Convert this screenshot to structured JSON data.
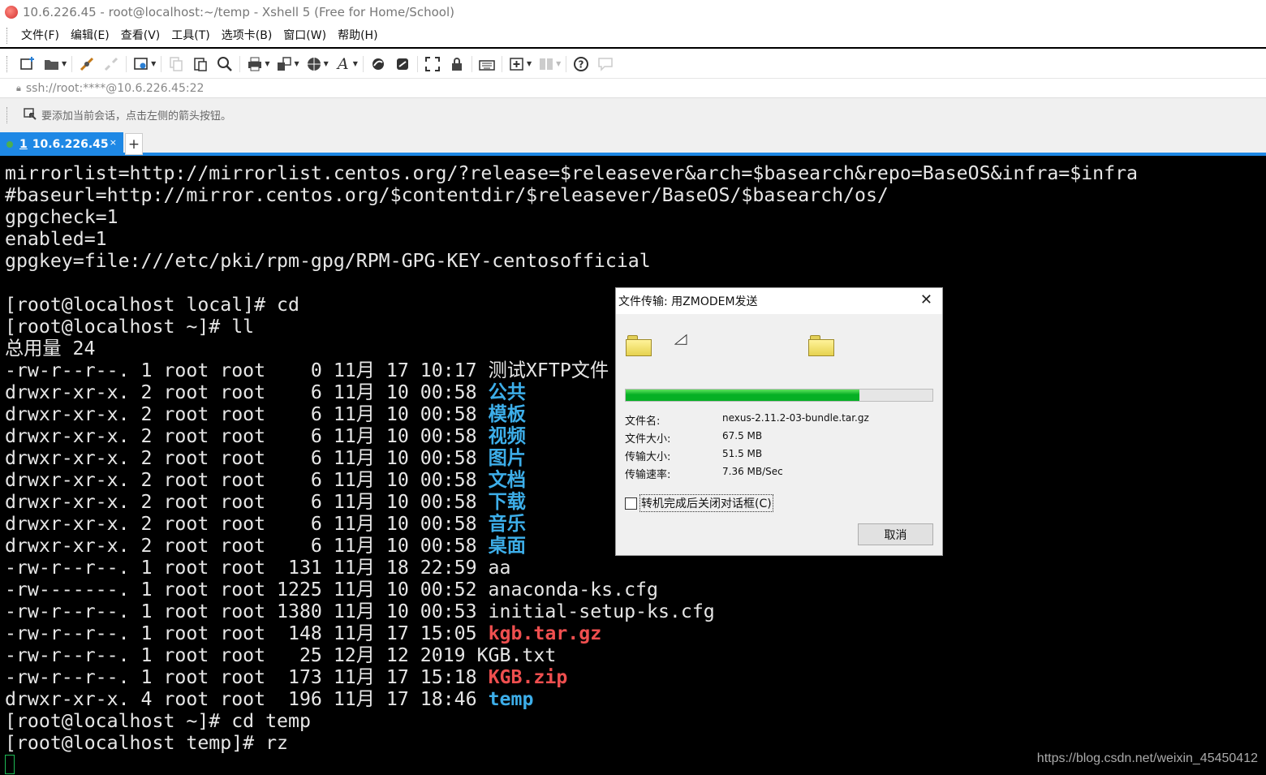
{
  "window": {
    "title": "10.6.226.45  - root@localhost:~/temp - Xshell 5 (Free for Home/School)"
  },
  "menu": [
    "文件(F)",
    "编辑(E)",
    "查看(V)",
    "工具(T)",
    "选项卡(B)",
    "窗口(W)",
    "帮助(H)"
  ],
  "toolbar": {
    "icons": [
      "new-session-icon",
      "open-folder-icon",
      "connect-icon",
      "disconnect-icon",
      "properties-icon",
      "copy-icon",
      "paste-icon",
      "find-icon",
      "print-icon",
      "transfer-icon",
      "globe-icon",
      "font-icon",
      "xftp-icon",
      "xagent-icon",
      "fullscreen-icon",
      "lock-icon",
      "keyboard-icon",
      "new-tab-icon",
      "layout-icon",
      "help-icon",
      "chat-icon"
    ]
  },
  "address": {
    "value": "ssh://root:****@10.6.226.45:22"
  },
  "hint": {
    "text": "要添加当前会话，点击左侧的箭头按钮。"
  },
  "tab": {
    "number": "1",
    "label": "10.6.226.45",
    "close": "×",
    "add": "+"
  },
  "terminal": {
    "lines": [
      [
        {
          "t": "mirrorlist=http://mirrorlist.centos.org/?release=$releasever&arch=$basearch&repo=BaseOS&infra=$infra",
          "c": ""
        }
      ],
      [
        {
          "t": "#baseurl=http://mirror.centos.org/$contentdir/$releasever/BaseOS/$basearch/os/",
          "c": ""
        }
      ],
      [
        {
          "t": "gpgcheck=1",
          "c": ""
        }
      ],
      [
        {
          "t": "enabled=1",
          "c": ""
        }
      ],
      [
        {
          "t": "gpgkey=file:///etc/pki/rpm-gpg/RPM-GPG-KEY-centosofficial",
          "c": ""
        }
      ],
      [
        {
          "t": "",
          "c": ""
        }
      ],
      [
        {
          "t": "[root@localhost local]# cd",
          "c": ""
        }
      ],
      [
        {
          "t": "[root@localhost ~]# ll",
          "c": ""
        }
      ],
      [
        {
          "t": "总用量 24",
          "c": ""
        }
      ],
      [
        {
          "t": "-rw-r--r--. 1 root root    0 11月 17 10:17 ",
          "c": ""
        },
        {
          "t": "测试XFTP文件",
          "c": ""
        }
      ],
      [
        {
          "t": "drwxr-xr-x. 2 root root    6 11月 10 00:58 ",
          "c": ""
        },
        {
          "t": "公共",
          "c": "c-blue"
        }
      ],
      [
        {
          "t": "drwxr-xr-x. 2 root root    6 11月 10 00:58 ",
          "c": ""
        },
        {
          "t": "模板",
          "c": "c-blue"
        }
      ],
      [
        {
          "t": "drwxr-xr-x. 2 root root    6 11月 10 00:58 ",
          "c": ""
        },
        {
          "t": "视频",
          "c": "c-blue"
        }
      ],
      [
        {
          "t": "drwxr-xr-x. 2 root root    6 11月 10 00:58 ",
          "c": ""
        },
        {
          "t": "图片",
          "c": "c-blue"
        }
      ],
      [
        {
          "t": "drwxr-xr-x. 2 root root    6 11月 10 00:58 ",
          "c": ""
        },
        {
          "t": "文档",
          "c": "c-blue"
        }
      ],
      [
        {
          "t": "drwxr-xr-x. 2 root root    6 11月 10 00:58 ",
          "c": ""
        },
        {
          "t": "下载",
          "c": "c-blue"
        }
      ],
      [
        {
          "t": "drwxr-xr-x. 2 root root    6 11月 10 00:58 ",
          "c": ""
        },
        {
          "t": "音乐",
          "c": "c-blue"
        }
      ],
      [
        {
          "t": "drwxr-xr-x. 2 root root    6 11月 10 00:58 ",
          "c": ""
        },
        {
          "t": "桌面",
          "c": "c-blue"
        }
      ],
      [
        {
          "t": "-rw-r--r--. 1 root root  131 11月 18 22:59 aa",
          "c": ""
        }
      ],
      [
        {
          "t": "-rw-------. 1 root root 1225 11月 10 00:52 anaconda-ks.cfg",
          "c": ""
        }
      ],
      [
        {
          "t": "-rw-r--r--. 1 root root 1380 11月 10 00:53 initial-setup-ks.cfg",
          "c": ""
        }
      ],
      [
        {
          "t": "-rw-r--r--. 1 root root  148 11月 17 15:05 ",
          "c": ""
        },
        {
          "t": "kgb.tar.gz",
          "c": "c-red"
        }
      ],
      [
        {
          "t": "-rw-r--r--. 1 root root   25 12月 12 2019 KGB.txt",
          "c": ""
        }
      ],
      [
        {
          "t": "-rw-r--r--. 1 root root  173 11月 17 15:18 ",
          "c": ""
        },
        {
          "t": "KGB.zip",
          "c": "c-red"
        }
      ],
      [
        {
          "t": "drwxr-xr-x. 4 root root  196 11月 17 18:46 ",
          "c": ""
        },
        {
          "t": "temp",
          "c": "c-blue"
        }
      ],
      [
        {
          "t": "[root@localhost ~]# cd temp",
          "c": ""
        }
      ],
      [
        {
          "t": "[root@localhost temp]# rz",
          "c": ""
        }
      ]
    ],
    "watermark": "https://blog.csdn.net/weixin_45450412"
  },
  "dialog": {
    "title": "文件传输: 用ZMODEM发送",
    "close": "✕",
    "progress": 0.7632,
    "rows": [
      {
        "label": "文件名:",
        "value": "nexus-2.11.2-03-bundle.tar.gz"
      },
      {
        "label": "文件大小:",
        "value": "67.5 MB"
      },
      {
        "label": "传输大小:",
        "value": "51.5 MB"
      },
      {
        "label": "传输速率:",
        "value": "7.36 MB/Sec"
      }
    ],
    "checkbox_label": "转机完成后关闭对话框(C)",
    "cancel_label": "取消"
  },
  "colors": {
    "accent": "#1e88e5",
    "dir": "#3daee9",
    "archive": "#ef4f4f",
    "progress": "#06b025"
  }
}
